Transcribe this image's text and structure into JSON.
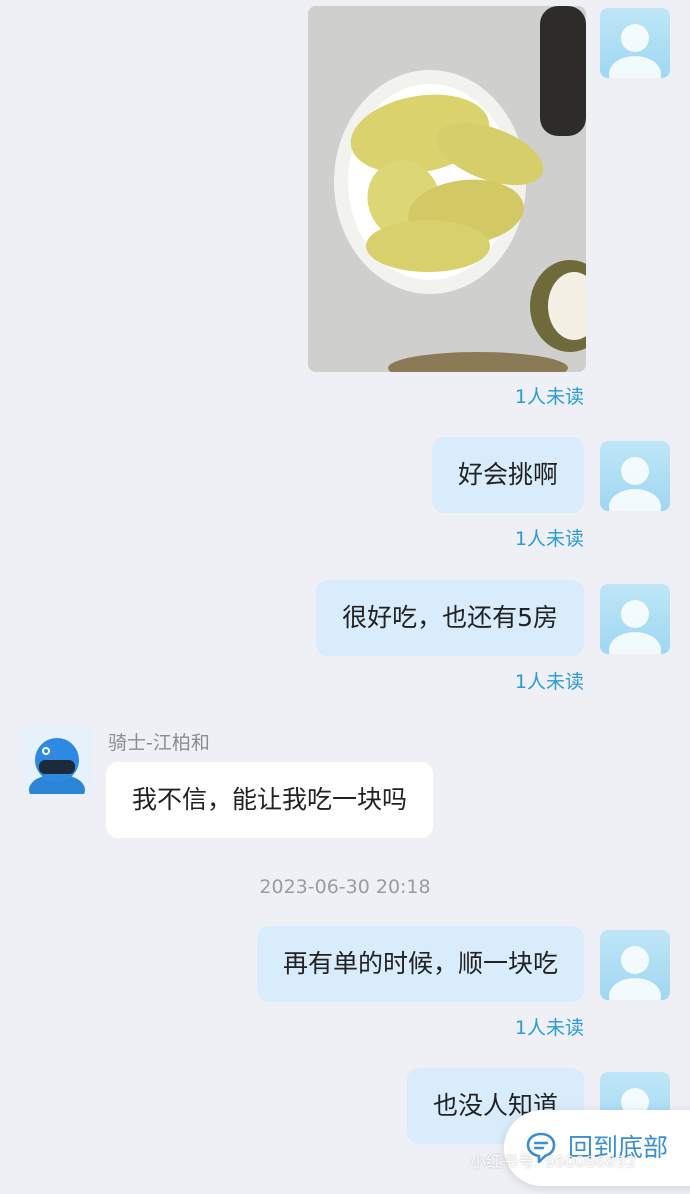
{
  "messages": {
    "unread_label": "1人未读",
    "m2_text": "好会挑啊",
    "m3_text": "很好吃，也还有5房",
    "rider_name": "骑士-江柏和",
    "m4_text": "我不信，能让我吃一块吗",
    "timestamp": "2023-06-30 20:18",
    "m5_text": "再有单的时候，顺一块吃",
    "m6_text": "也没人知道"
  },
  "back_to_bottom": {
    "label": "回到底部",
    "icon": "chat-bubble-icon"
  },
  "watermark": {
    "text": "小红书号: 960086892"
  },
  "colors": {
    "background": "#eef0f5",
    "my_bubble": "#d9ecfb",
    "other_bubble": "#ffffff",
    "unread": "#2a9bd6"
  }
}
